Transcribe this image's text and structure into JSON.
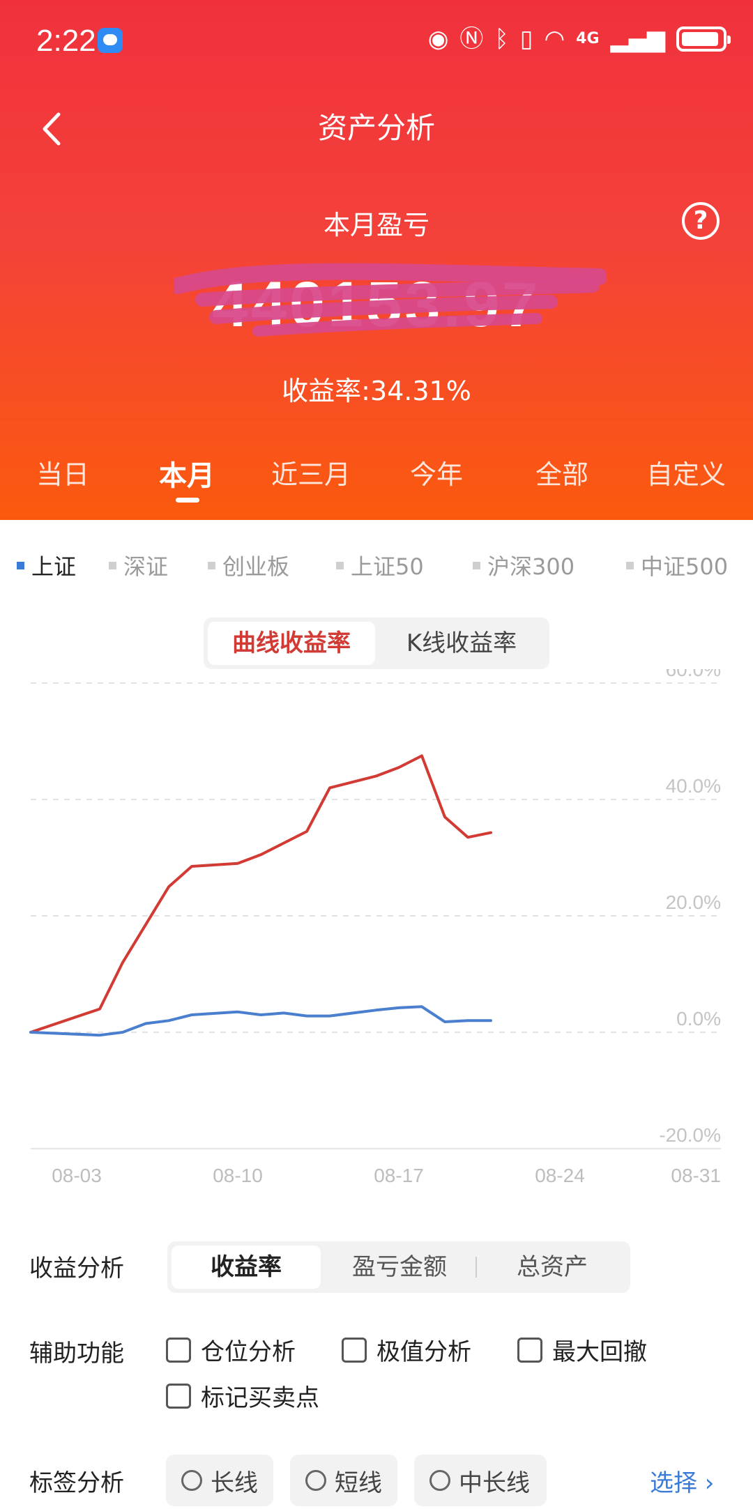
{
  "status_bar": {
    "time": "2:22",
    "network": "4G"
  },
  "header": {
    "title": "资产分析",
    "month_pl_label": "本月盈亏",
    "pl_amount": "440153.97",
    "yield_text": "收益率:34.31%"
  },
  "period_tabs": [
    "当日",
    "本月",
    "近三月",
    "今年",
    "全部",
    "自定义"
  ],
  "active_period": "本月",
  "index_selector": {
    "items": [
      "上证",
      "深证",
      "创业板",
      "上证50",
      "沪深300",
      "中证500"
    ],
    "active": "上证",
    "active_color": "#3b7bd8"
  },
  "chart_toggle": {
    "options": [
      "曲线收益率",
      "K线收益率"
    ],
    "active": "曲线收益率"
  },
  "chart_data": {
    "type": "line",
    "xlim": [
      "2023-08-01",
      "2023-08-31"
    ],
    "ylim": [
      -20,
      60
    ],
    "y_ticks": [
      "60.0%",
      "40.0%",
      "20.0%",
      "0.0%",
      "-20.0%"
    ],
    "x_ticks": [
      "08-03",
      "08-10",
      "08-17",
      "08-24",
      "08-31"
    ],
    "grid": true,
    "series": [
      {
        "color": "#d23a34",
        "points": [
          [
            "2023-08-01",
            0.0
          ],
          [
            "2023-08-04",
            4.0
          ],
          [
            "2023-08-05",
            12.0
          ],
          [
            "2023-08-07",
            25.0
          ],
          [
            "2023-08-08",
            28.5
          ],
          [
            "2023-08-10",
            29.0
          ],
          [
            "2023-08-11",
            30.5
          ],
          [
            "2023-08-13",
            34.5
          ],
          [
            "2023-08-14",
            42.0
          ],
          [
            "2023-08-16",
            44.0
          ],
          [
            "2023-08-17",
            45.5
          ],
          [
            "2023-08-18",
            47.5
          ],
          [
            "2023-08-19",
            37.0
          ],
          [
            "2023-08-20",
            33.5
          ],
          [
            "2023-08-21",
            34.3
          ]
        ]
      },
      {
        "color": "#4a7fcf",
        "points": [
          [
            "2023-08-01",
            0.0
          ],
          [
            "2023-08-04",
            -0.5
          ],
          [
            "2023-08-05",
            0.0
          ],
          [
            "2023-08-06",
            1.5
          ],
          [
            "2023-08-07",
            2.0
          ],
          [
            "2023-08-08",
            3.0
          ],
          [
            "2023-08-10",
            3.5
          ],
          [
            "2023-08-11",
            3.0
          ],
          [
            "2023-08-12",
            3.3
          ],
          [
            "2023-08-13",
            2.8
          ],
          [
            "2023-08-14",
            2.8
          ],
          [
            "2023-08-16",
            3.8
          ],
          [
            "2023-08-17",
            4.2
          ],
          [
            "2023-08-18",
            4.4
          ],
          [
            "2023-08-19",
            1.8
          ],
          [
            "2023-08-20",
            2.0
          ],
          [
            "2023-08-21",
            2.0
          ]
        ]
      }
    ]
  },
  "profit_analysis": {
    "label": "收益分析",
    "options": [
      "收益率",
      "盈亏金额",
      "总资产"
    ],
    "active": "收益率"
  },
  "aux_functions": {
    "label": "辅助功能",
    "options": [
      "仓位分析",
      "极值分析",
      "最大回撤",
      "标记买卖点"
    ]
  },
  "tag_analysis": {
    "label": "标签分析",
    "options": [
      "长线",
      "短线",
      "中长线"
    ],
    "select_label": "选择"
  }
}
